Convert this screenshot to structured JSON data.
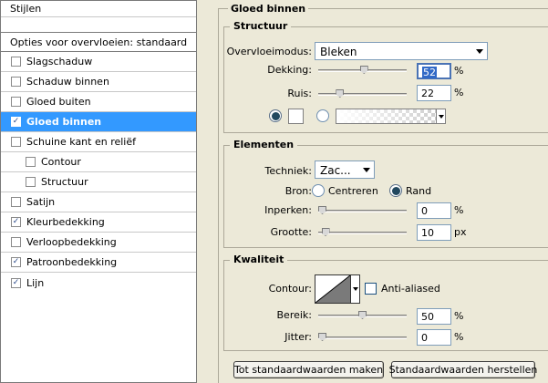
{
  "left_panel": {
    "header": "Stijlen",
    "options_row": "Opties voor overvloeien: standaard",
    "items": [
      {
        "label": "Slagschaduw",
        "checked": false
      },
      {
        "label": "Schaduw binnen",
        "checked": false
      },
      {
        "label": "Gloed buiten",
        "checked": false
      },
      {
        "label": "Gloed binnen",
        "checked": true,
        "selected": true
      },
      {
        "label": "Schuine kant en reliëf",
        "checked": false
      },
      {
        "label": "Contour",
        "checked": false,
        "sub": true
      },
      {
        "label": "Structuur",
        "checked": false,
        "sub": true
      },
      {
        "label": "Satijn",
        "checked": false
      },
      {
        "label": "Kleurbedekking",
        "checked": true
      },
      {
        "label": "Verloopbedekking",
        "checked": false
      },
      {
        "label": "Patroonbedekking",
        "checked": true
      },
      {
        "label": "Lijn",
        "checked": true
      }
    ]
  },
  "panel_title": "Gloed binnen",
  "structuur": {
    "title": "Structuur",
    "blend_label": "Overvloeimodus:",
    "blend_value": "Bleken",
    "opacity_label": "Dekking:",
    "opacity_value": "52",
    "opacity_unit": "%",
    "opacity_level": 0.52,
    "noise_label": "Ruis:",
    "noise_value": "22",
    "noise_unit": "%",
    "noise_level": 0.22
  },
  "elementen": {
    "title": "Elementen",
    "technique_label": "Techniek:",
    "technique_value": "Zac...",
    "source_label": "Bron:",
    "source_center": "Centreren",
    "source_edge": "Rand",
    "choke_label": "Inperken:",
    "choke_value": "0",
    "choke_unit": "%",
    "choke_level": 0,
    "size_label": "Grootte:",
    "size_value": "10",
    "size_unit": "px",
    "size_level": 0.04
  },
  "kwaliteit": {
    "title": "Kwaliteit",
    "contour_label": "Contour:",
    "antialiased_label": "Anti-aliased",
    "range_label": "Bereik:",
    "range_value": "50",
    "range_unit": "%",
    "range_level": 0.5,
    "jitter_label": "Jitter:",
    "jitter_value": "0",
    "jitter_unit": "%",
    "jitter_level": 0
  },
  "buttons": {
    "make_default": "Tot standaardwaarden maken",
    "reset_default": "Standaardwaarden herstellen"
  }
}
